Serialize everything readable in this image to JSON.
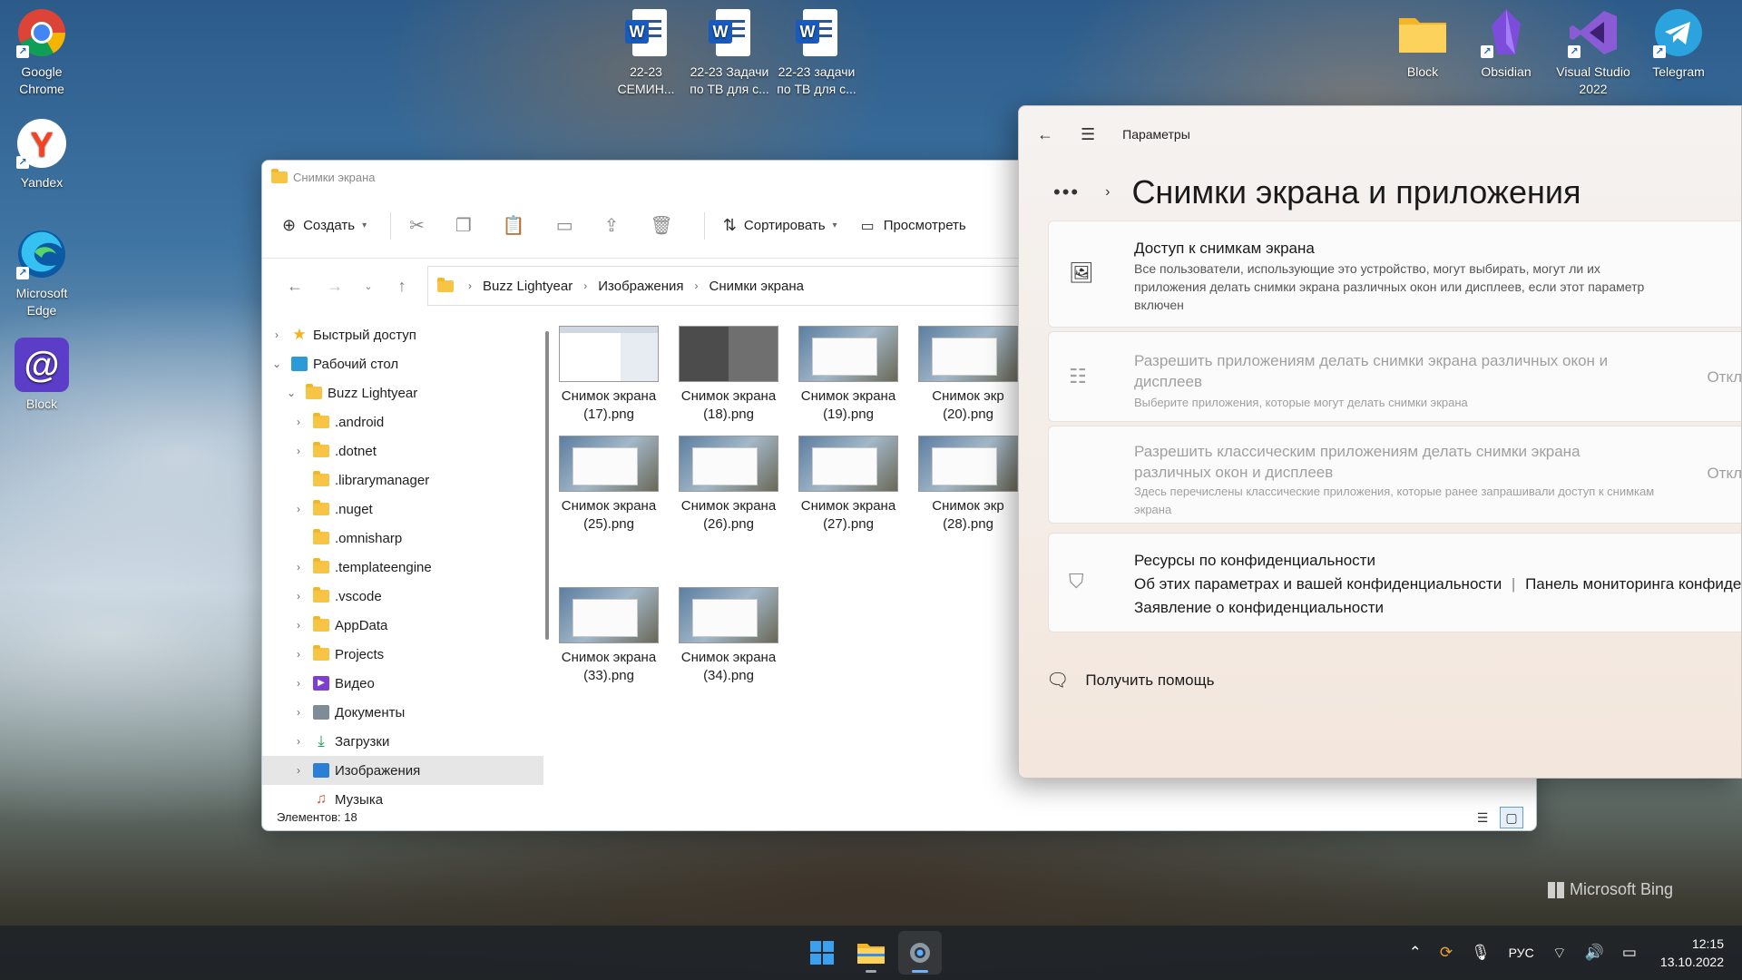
{
  "desktop": {
    "left_icons": [
      {
        "label": "Google Chrome"
      },
      {
        "label": "Yandex"
      },
      {
        "label": "Microsoft Edge"
      },
      {
        "label": "Block"
      }
    ],
    "top_icons": [
      {
        "label": "22-23 СЕМИН..."
      },
      {
        "label": "22-23 Задачи по ТВ для с..."
      },
      {
        "label": "22-23 задачи по ТВ для с..."
      }
    ],
    "right_icons": [
      {
        "label": "Block"
      },
      {
        "label": "Obsidian"
      },
      {
        "label": "Visual Studio 2022"
      },
      {
        "label": "Telegram"
      }
    ],
    "watermark": "Microsoft Bing"
  },
  "explorer": {
    "title": "Снимки экрана",
    "toolbar": {
      "create": "Создать",
      "sort": "Сортировать",
      "view": "Просмотреть"
    },
    "breadcrumb": [
      "Buzz Lightyear",
      "Изображения",
      "Снимки экрана"
    ],
    "tree": [
      {
        "label": "Быстрый доступ"
      },
      {
        "label": "Рабочий стол"
      },
      {
        "label": "Buzz Lightyear"
      },
      {
        "label": ".android"
      },
      {
        "label": ".dotnet"
      },
      {
        "label": ".librarymanager"
      },
      {
        "label": ".nuget"
      },
      {
        "label": ".omnisharp"
      },
      {
        "label": ".templateengine"
      },
      {
        "label": ".vscode"
      },
      {
        "label": "AppData"
      },
      {
        "label": "Projects"
      },
      {
        "label": "Видео"
      },
      {
        "label": "Документы"
      },
      {
        "label": "Загрузки"
      },
      {
        "label": "Изображения"
      },
      {
        "label": "Музыка"
      }
    ],
    "files": [
      {
        "line1": "Снимок экрана",
        "line2": "(17).png"
      },
      {
        "line1": "Снимок экрана",
        "line2": "(18).png"
      },
      {
        "line1": "Снимок экрана",
        "line2": "(19).png"
      },
      {
        "line1": "Снимок экр",
        "line2": "(20).png"
      },
      {
        "line1": "Снимок экрана",
        "line2": "(25).png"
      },
      {
        "line1": "Снимок экрана",
        "line2": "(26).png"
      },
      {
        "line1": "Снимок экрана",
        "line2": "(27).png"
      },
      {
        "line1": "Снимок экр",
        "line2": "(28).png"
      },
      {
        "line1": "Снимок экрана",
        "line2": "(33).png"
      },
      {
        "line1": "Снимок экрана",
        "line2": "(34).png"
      }
    ],
    "status": "Элементов: 18"
  },
  "settings": {
    "app_title": "Параметры",
    "page_title": "Снимки экрана и приложения",
    "cards": {
      "access": {
        "title": "Доступ к снимкам экрана",
        "desc": "Все пользователи, использующие это устройство, могут выбирать, могут ли их приложения делать снимки экрана различных окон или дисплеев, если этот параметр включен"
      },
      "apps": {
        "title": "Разрешить приложениям делать снимки экрана различных окон и дисплеев",
        "desc": "Выберите приложения, которые могут делать снимки экрана",
        "value": "Откл"
      },
      "classic": {
        "title": "Разрешить классическим приложениям делать снимки экрана различных окон и дисплеев",
        "desc": "Здесь перечислены классические приложения, которые ранее запрашивали доступ к снимкам экрана",
        "value": "Откл"
      },
      "privacy": {
        "title": "Ресурсы по конфиденциальности",
        "link1": "Об этих параметрах и вашей конфиденциальности",
        "link2": "Панель мониторинга конфиденц",
        "link3": "Заявление о конфиденциальности"
      }
    },
    "help": "Получить помощь"
  },
  "taskbar": {
    "lang": "РУС",
    "time": "12:15",
    "date": "13.10.2022"
  }
}
